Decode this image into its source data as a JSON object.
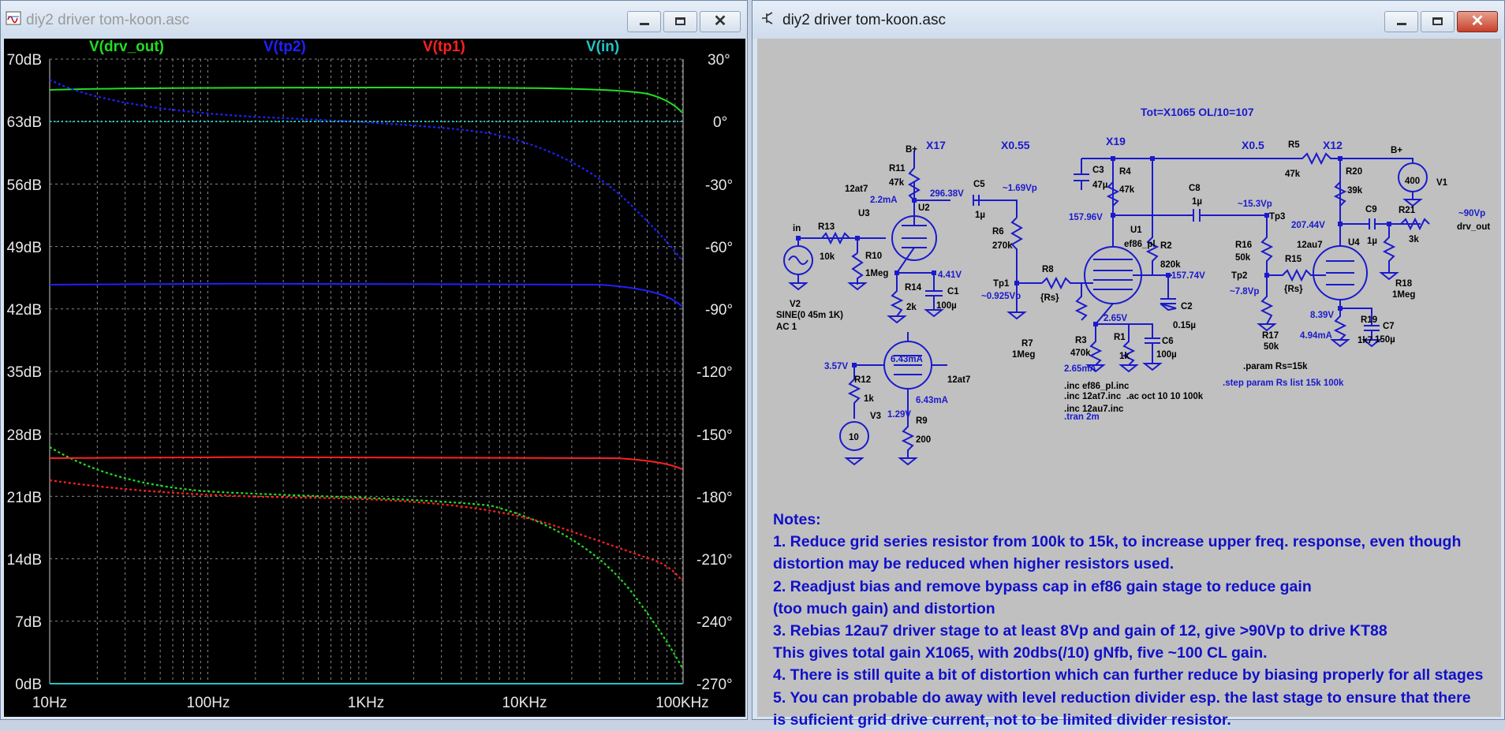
{
  "left_window": {
    "title": "diy2 driver tom-koon.asc",
    "buttons": {
      "minimize": "—",
      "maximize": "☐",
      "close": "✕"
    },
    "traces": [
      {
        "name": "V(drv_out)",
        "color": "#22dd22"
      },
      {
        "name": "V(tp2)",
        "color": "#2020ff"
      },
      {
        "name": "V(tp1)",
        "color": "#ff2020"
      },
      {
        "name": "V(in)",
        "color": "#22c4c4"
      }
    ],
    "y_left_ticks": [
      "70dB",
      "63dB",
      "56dB",
      "49dB",
      "42dB",
      "35dB",
      "28dB",
      "21dB",
      "14dB",
      "7dB",
      "0dB"
    ],
    "y_right_ticks": [
      "30°",
      "0°",
      "-30°",
      "-60°",
      "-90°",
      "-120°",
      "-150°",
      "-180°",
      "-210°",
      "-240°",
      "-270°"
    ],
    "x_ticks": [
      "10Hz",
      "100Hz",
      "1KHz",
      "10KHz",
      "100KHz"
    ]
  },
  "right_window": {
    "title": "diy2 driver tom-koon.asc",
    "buttons": {
      "minimize": "—",
      "maximize": "☐",
      "close": "✕"
    },
    "schematic": {
      "headline": "Tot=X1065 OL/10=107",
      "stage_gains": {
        "x17": "X17",
        "x055": "X0.55",
        "x19": "X19",
        "x05": "X0.5",
        "x12": "X12"
      },
      "labels": {
        "b_plus_left": "B+",
        "b_plus_right": "B+",
        "r11": "R11",
        "r11v": "47k",
        "u3type": "12at7",
        "u3": "U3",
        "u2": "U2",
        "i_22ma": "2.2mA",
        "v296": "296.38V",
        "c5": "C5",
        "c5v": "1µ",
        "vp169": "~1.69Vp",
        "r6": "R6",
        "r6v": "270k",
        "r13": "R13",
        "r13v": "10k",
        "in": "in",
        "r10": "R10",
        "r10v": "1Meg",
        "v441": "4.41V",
        "r14": "R14",
        "r14v": "2k",
        "c1": "C1",
        "c1v": "100µ",
        "v2": "V2",
        "v2v": "SINE(0 45m 1K)",
        "v2ac": "AC 1",
        "tp1": "Tp1",
        "vp0925": "~0.925Vp",
        "r8": "R8",
        "rs1": "{Rs}",
        "r7": "R7",
        "r7v": "1Meg",
        "c3": "C3",
        "c3v": "47µ",
        "r4": "R4",
        "r4v": "47k",
        "v15796": "157.96V",
        "u1": "U1",
        "u1type": "ef86_pl",
        "r2": "R2",
        "r2v": "820k",
        "v15774": "157.74V",
        "c2": "C2",
        "c2v": "0.15µ",
        "v265": "2.65V",
        "r3": "R3",
        "r3v": "470k",
        "r1": "R1",
        "r1v": "1k",
        "c6": "C6",
        "c6v": "100µ",
        "i265": "2.65mA",
        "c8": "C8",
        "c8v": "1µ",
        "vp153": "~15.3Vp",
        "tp3": "Tp3",
        "r16": "R16",
        "r16v": "50k",
        "tp2": "Tp2",
        "vp78": "~7.8Vp",
        "r15": "R15",
        "rs2": "{Rs}",
        "r17": "R17",
        "r17v": "50k",
        "r5": "R5",
        "r5v": "47k",
        "r20": "R20",
        "r20v": "39k",
        "v20744": "207.44V",
        "u4type": "12au7",
        "u4": "U4",
        "c9": "C9",
        "c9v": "1µ",
        "r21": "R21",
        "r21v": "3k",
        "vp90": "~90Vp",
        "drv_out": "drv_out",
        "v839": "8.39V",
        "i494": "4.94mA",
        "r19": "R19",
        "r19v": "1k7",
        "c7": "C7",
        "c7v": "150µ",
        "r18": "R18",
        "r18v": "1Meg",
        "v1": "V1",
        "v1v": "400",
        "i643a": "6.43mA",
        "v357": "3.57V",
        "r12": "R12",
        "r12v": "1k",
        "v3": "V3",
        "v3v": "10",
        "i643b": "6.43mA",
        "v129": "1.29V",
        "r9": "R9",
        "r9v": "200",
        "u5type": "12at7",
        "inc1": ".inc ef86_pl.inc",
        "inc2": ".inc 12at7.inc",
        "inc3": ".inc 12au7.inc",
        "tran": ".tran 2m",
        "ac": ".ac oct 10 10 100k",
        "param": ".param Rs=15k",
        "step": ".step param Rs list 15k 100k"
      }
    },
    "notes": [
      "Notes:",
      "1. Reduce grid series resistor from 100k to 15k, to increase upper freq. response, even though",
      "distortion may be reduced when higher resistors used.",
      "2. Readjust bias and remove bypass cap in ef86 gain stage to reduce gain",
      "(too much gain) and distortion",
      "3. Rebias 12au7 driver stage to at least 8Vp and gain of 12, give >90Vp to drive KT88",
      "This gives total gain X1065, with 20dbs(/10) gNfb, five ~100 CL gain.",
      "4. There is still quite a bit of distortion which can further reduce by biasing properly for all stages",
      "5. You can probable do away with level reduction divider esp. the last stage to ensure that there",
      "is suficient grid drive current, not to be limited divider resistor."
    ]
  }
}
